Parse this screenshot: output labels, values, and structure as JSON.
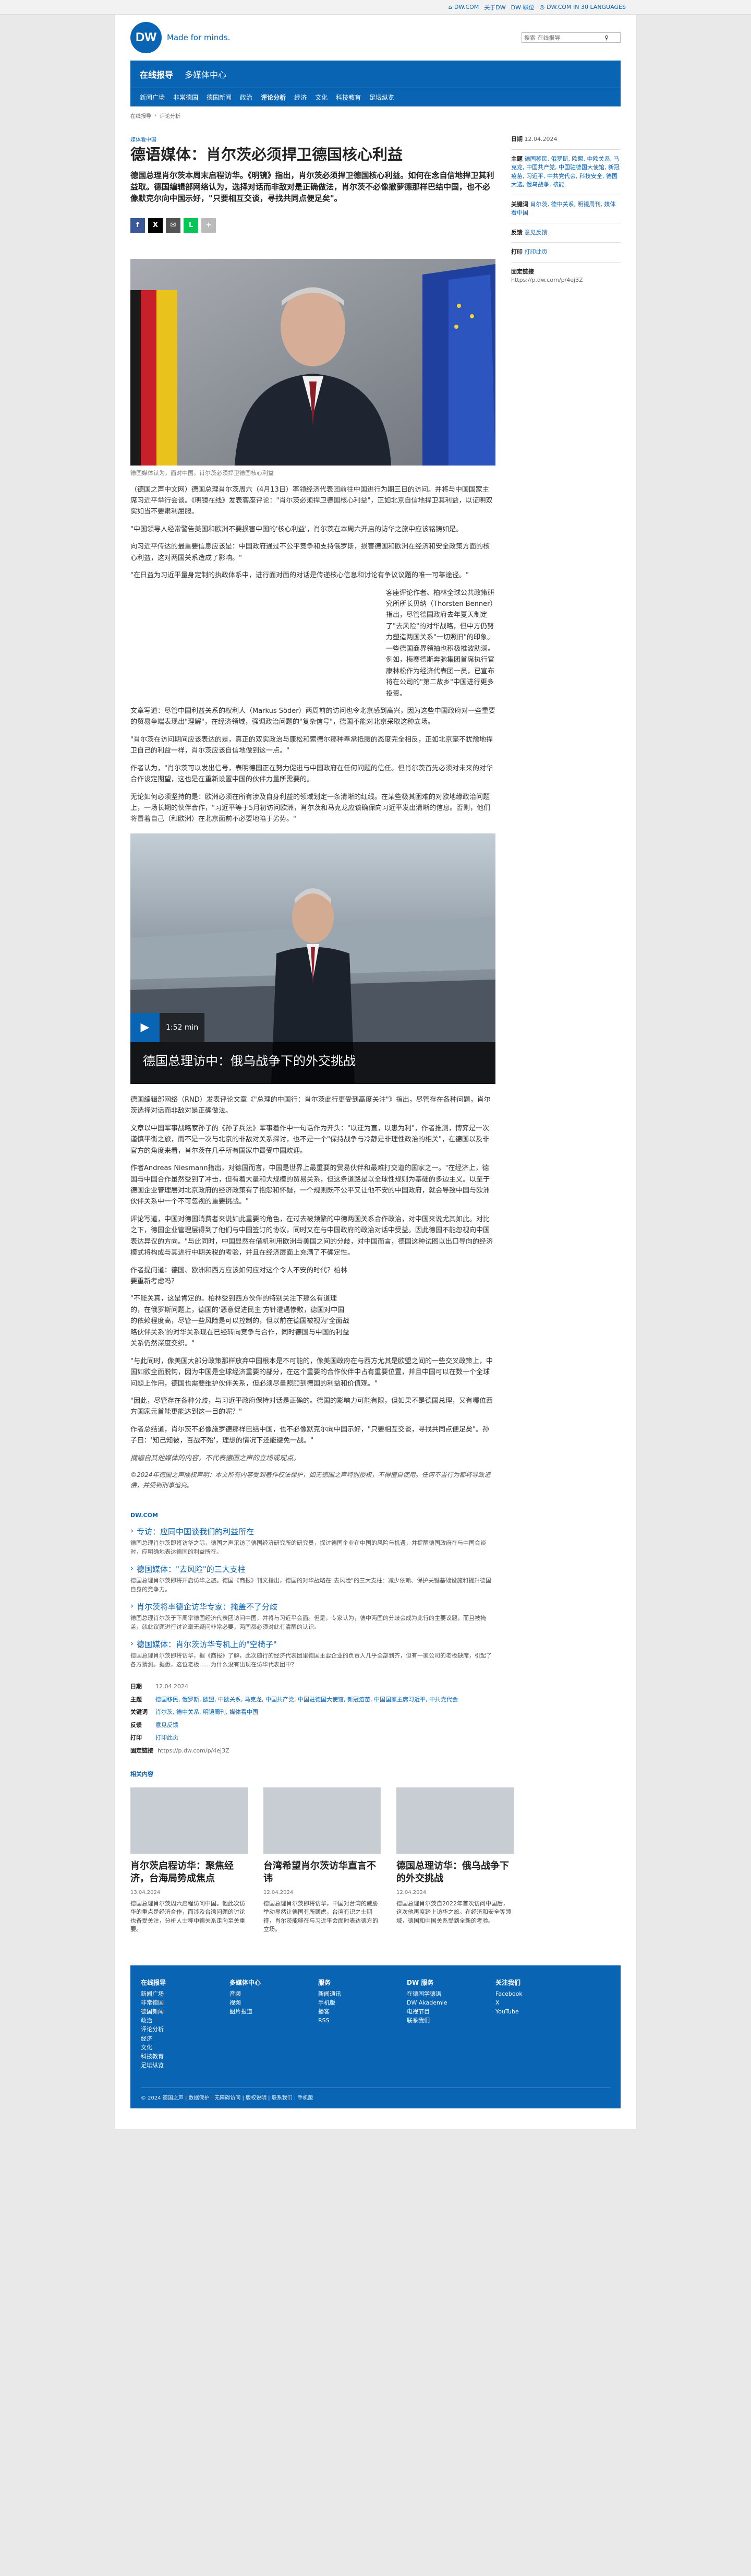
{
  "util": {
    "links": [
      "DW.COM",
      "关于DW",
      "DW 职位",
      "DW.COM IN 30 LANGUAGES"
    ]
  },
  "brand": {
    "logo": "DW",
    "tagline": "Made for minds."
  },
  "search": {
    "placeholder": "搜索 在线报导"
  },
  "nav": {
    "top": [
      "在线报导",
      "多媒体中心"
    ],
    "sub": [
      "新闻广场",
      "非常德国",
      "德国新闻",
      "政治",
      "评论分析",
      "经济",
      "文化",
      "科技教育",
      "足坛纵览"
    ]
  },
  "breadcrumb": [
    "在线报导",
    "评论分析"
  ],
  "article": {
    "kicker": "媒体看中国",
    "title": "德语媒体：肖尔茨必须捍卫德国核心利益",
    "lead": "德国总理肖尔茨本周末启程访华。《明镜》指出，肖尔茨必须捍卫德国核心利益。如何在念自信地捍卫其利益取。德国编辑部网络认为，选择对话而非敌对是正确做法，肖尔茨不必像撤萝德那样巴结中国，也不必像默克尔向中国示好，\"只要相互交谈，寻找共同点便足矣\"。",
    "share": [
      "f",
      "X",
      "✉",
      "L",
      "+"
    ],
    "hero_caption": "德国媒体认为，面对中国，肖尔茨必须捍卫德国核心利益",
    "p1": "（德国之声中文网）德国总理肖尔茨周六（4月13日）率领经济代表团前往中国进行为期三日的访问。并将与中国国家主席习近平举行会谈。《明镜在线》发表客座评论：\"肖尔茨必须捍卫德国核心利益\"，正如北京自信地捍卫其利益，以证明双实如当不要肃利屈服。",
    "p2": "\"中国领导人经常警告美国和欧洲不要损害中国的'核心利益'，肖尔茨在本周六开启的访华之旅中应该铭铸如是。",
    "p3": "向习近平传达的最重要信息应该是：中国政府通过不公平竞争和支持俄罗斯，损害德国和欧洲在经济和安全政策方面的核心利益，这对两国关系造成了影响。\"",
    "p4": "\"在日益为习近平量身定制的执政体系中，进行面对面的对话是传递核心信息和讨论有争议议题的唯一可靠途径。\"",
    "p5": "客座评论作者、柏林全球公共政策研究所所长贝纳（Thorsten Benner）指出，尽管德国政府去年夏天制定了\"去风险\"的对华战略，但中方仍努力塑造两国关系\"一切照旧\"的印象。一些德国商界领袖也积极推波助澜。例如，梅赛德斯奔驰集团首席执行官康林松作为经济代表团一员，已宣布将在公司的\"第二故乡\"中国进行更多投资。",
    "p6": "文章写道：尽管中国利益关系的权利人（Markus Söder）两周前的访问也令北京感到高兴，因为这些中国政府对一些重要的贸易争端表现出\"理解\"，在经济领域，强调政治问题的\"复杂信号\"，德国不能对北京采取这种立场。",
    "p7": "\"肖尔茨在访问期间应该表达的是，真正的双实政治与康松和索德尔那种奉承抵腰的态度完全相反，正如北京毫不犹豫地捍卫自己的利益一样，肖尔茨应该自信地做到这一点。\"",
    "p8": "作者认为，\"肖尔茨可以发出信号，表明德国正在努力促进与中国政府在任何问题的信任。但肖尔茨首先必须对未来的对华合作设定期望，这也是在重新设置中国的伙伴力量所需要的。",
    "p9": "无论如何必须坚持的是：欧洲必须在所有涉及自身利益的领域划定一条清晰的红线。在某些极其困难的对欧地缘政治问题上，一场长期的伙伴合作，\"习近平等于5月初访问欧洲，肖尔茨和马克龙应该确保向习近平发出清晰的信息。否则，他们将冒着自己（和欧洲）在北京面前不必要地陷于劣势。\"",
    "video_title": "德国总理访中：俄乌战争下的外交挑战",
    "video_duration": "1:52 min",
    "p10": "德国编辑部网络（RND）发表评论文章《\"总理的中国行：肖尔茨此行更受到高度关注\"》指出，尽管存在各种问题，肖尔茨选择对话而非敌对是正确做法。",
    "p11": "文章以中国军事战略家孙子的《孙子兵法》军事着作中一句话作为开头：\"以迂为直，以患为利\"，作者推测，博弈是一次谨慎平衡之旅，而不是一次与北京的非敌对关系探讨，也不是一个\"保持战争与冷静是非理性政治的相关\"，在德国以及非官方的角度来看，肖尔茨在几乎所有国家中最受中国欢迎。",
    "p12": "作者Andreas Niesmann指出，对德国而言，中国是世界上最重要的贸易伙伴和最难打交道的国家之一。\"在经济上，德国与中国合作虽然受到了冲击，但有着大量和大规模的贸易关系，但这条道路是以全球性规则为基础的多边主义。以至于德国企业管理层对北京政府的经济政策有了抱怨和怀疑，一个规则既不公平又让他不安的中国政府，就会导致中国与欧洲伙伴关系中一个不可忽视的重要挑战。\"",
    "p13": "评论写道，中国对德国消费者来说如此重要的角色，在过去被频繁的中德两国关系合作政治，对中国来说尤其如此。对比之下，德国企业管理层得到了他们与中国签订的协议，同时又在与中国政府的政治对话中受益。因此德国不能忽视向中国表达异议的方向。\"与此同时，中国显然在借机利用欧洲与美国之间的分歧，对中国而言，德国这种试图以出口导向的经济模式将构成与其进行中期关税的考验，并且在经济层面上充满了不确定性。",
    "p14": "作者提问道：德国、欧洲和西方应该如何应对这个令人不安的时代？柏林要重新考虑吗？",
    "p15": "\"不能关真，这是肯定的。柏林受到西方伙伴的特别关注下那么有道理的，在俄罗斯问题上，德国的'恶意促进民主'方针遭遇惨败，德国对中国的依赖程度高，尽管一些风险是可以控制的，但以前在德国被视为'全面战略伙伴关系'的对华关系现在已经转向竞争与合作，同时德国与中国的利益关系仍然深度交织。\"",
    "p16": "\"与此同时，像美国大部分政策那样放弃中国根本是不可能的，像美国政府在与西方尤其是欧盟之间的一些交叉政策上，中国如欲全面脱钩，因为中国是全球经济重要的部分，在这个重要的合作伙伴中占有重要位置，并且中国可以在数十个全球问题上作用，德国也需要维护伙伴关系，但必须尽量照顾到德国的利益和价值观。\"",
    "p17": "\"因此，尽管存在各种分歧，与习近平政府保持对话是正确的。德国的影响力可能有限，但如果不是德国总理，又有哪位西方国家元首能更能达到这一目的呢？\"",
    "p18": "作者总结道，肖尔茨不必像施罗德那样巴结中国，也不必像默克尔向中国示好，\"只要相互交谈，寻找共同点便足矣\"。孙子曰：'知己知彼，百战不殆'，理想的情况下还能避免一战。\"",
    "disclaimer": "摘编自其他媒体的内容，不代表德国之声的立场或观点。",
    "copyright": "©2024年德国之声版权声明：本文所有内容受到著作权法保护，如无德国之声特别授权，不得擅自使用。任何不当行为都将导致追偿，并受到刑事追究。"
  },
  "related": {
    "header": "DW.COM",
    "items": [
      {
        "title": "专访：应同中国谈我们的利益所在",
        "desc": "德国总理肖尔茨即将访华之际，德国之声采访了德国经济研究所的研究员，探讨德国企业在中国的风险与机遇，并提醒德国政府在与中国会谈时，应明确地表达德国的利益所在。"
      },
      {
        "title": "德国媒体：\"去风险\"的三大支柱",
        "desc": "德国总理肖尔茨即将开启访华之旅。德国《商报》刊文指出，德国的对华战略在\"去风险\"的三大支柱：减少依赖、保护关键基础设施和提升德国自身的竞争力。"
      },
      {
        "title": "肖尔茨将率德企访华专家：掩盖不了分歧",
        "desc": "德国总理肖尔茨于下周率德国经济代表团访问中国，并将与习近平会面。但是，专家认为，德中两国的分歧会成为此行的主要议题，而且被掩盖，就此议题进行讨论毫无疑问非常必要，两国都必须对此有清醒的认识。"
      },
      {
        "title": "德国媒体：肖尔茨访华专机上的\"空椅子\"",
        "desc": "德国总理肖尔茨即将访华，据《商报》了解，此次随行的经济代表团里德国主要企业的负责人几乎全部到齐，但有一家公司的老板缺席，引起了各方猜测。据悉，这位老板……为什么没有出现在访华代表团中？"
      }
    ]
  },
  "meta": {
    "date_label": "日期",
    "date": "12.04.2024",
    "topics_label": "主题",
    "topics": "德国移民, 俄罗斯, 欧盟, 中欧关系, 马克龙, 中国共产党, 中国驻德国大使馆, 新冠疫苗, 中国国家主席习近平, 中共党代会",
    "keywords_label": "关键词",
    "keywords": "肖尔茨, 德中关系, 明镜周刊, 媒体看中国",
    "feedback_label": "反馈",
    "feedback": "意见反馈",
    "print_label": "打印",
    "print": "打印此页",
    "permalink_label": "固定链接",
    "permalink": "https://p.dw.com/p/4ej3Z"
  },
  "side": {
    "date_label": "日期",
    "date": "12.04.2024",
    "topics_label": "主题",
    "topics": "德国移民, 俄罗斯, 欧盟, 中欧关系, 马克龙, 中国共产党, 中国驻德国大使馆, 新冠疫苗, 习近平, 中共党代会, 科技安全, 德国大选, 俄乌战争, 核能",
    "keywords_label": "关键词",
    "keywords": "肖尔茨, 德中关系, 明镜周刊, 媒体看中国",
    "feedback_label": "反馈",
    "feedback": "意见反馈",
    "print_label": "打印",
    "print": "打印此页",
    "permalink_label": "固定链接",
    "permalink": "https://p.dw.com/p/4ej3Z"
  },
  "teasers": {
    "header": "相关内容",
    "items": [
      {
        "title": "肖尔茨启程访华：聚焦经济，台海局势成焦点",
        "date": "13.04.2024",
        "text": "德国总理肖尔茨周六启程访问中国。他此次访华的重点是经济合作，而涉及台湾问题的讨论也备受关注，分析人士称中德关系走向至关重要。"
      },
      {
        "title": "台湾希望肖尔茨访华直言不讳",
        "date": "12.04.2024",
        "text": "德国总理肖尔茨即将访华，中国对台湾的威胁举动显然让德国有所顾虑，台湾有识之士期待，肖尔茨能够在与习近平会面时表达德方的立场。"
      },
      {
        "title": "德国总理访华：俄乌战争下的外交挑战",
        "date": "12.04.2024",
        "text": "德国总理肖尔茨自2022年首次访问中国后，这次他再度踏上访华之旅。在经济和安全等领域，德国和中国关系受到全新的考验。"
      }
    ]
  },
  "footer": {
    "cols": [
      {
        "head": "在线报导",
        "items": [
          "新闻广场",
          "非常德国",
          "德国新闻",
          "政治",
          "评论分析",
          "经济",
          "文化",
          "科技教育",
          "足坛纵览"
        ]
      },
      {
        "head": "多媒体中心",
        "items": [
          "音频",
          "视频",
          "图片报道"
        ]
      },
      {
        "head": "服务",
        "items": [
          "新闻通讯",
          "手机版",
          "播客",
          "RSS"
        ]
      },
      {
        "head": "DW 服务",
        "items": [
          "在德国学德语",
          "DW Akademie",
          "电视节目",
          "联系我们"
        ]
      },
      {
        "head": "关注我们",
        "items": [
          "Facebook",
          "X",
          "YouTube"
        ]
      }
    ],
    "legal": "© 2024 德国之声 | 数据保护 | 无障碍访问 | 版权说明 | 联系我们 | 手机版"
  }
}
